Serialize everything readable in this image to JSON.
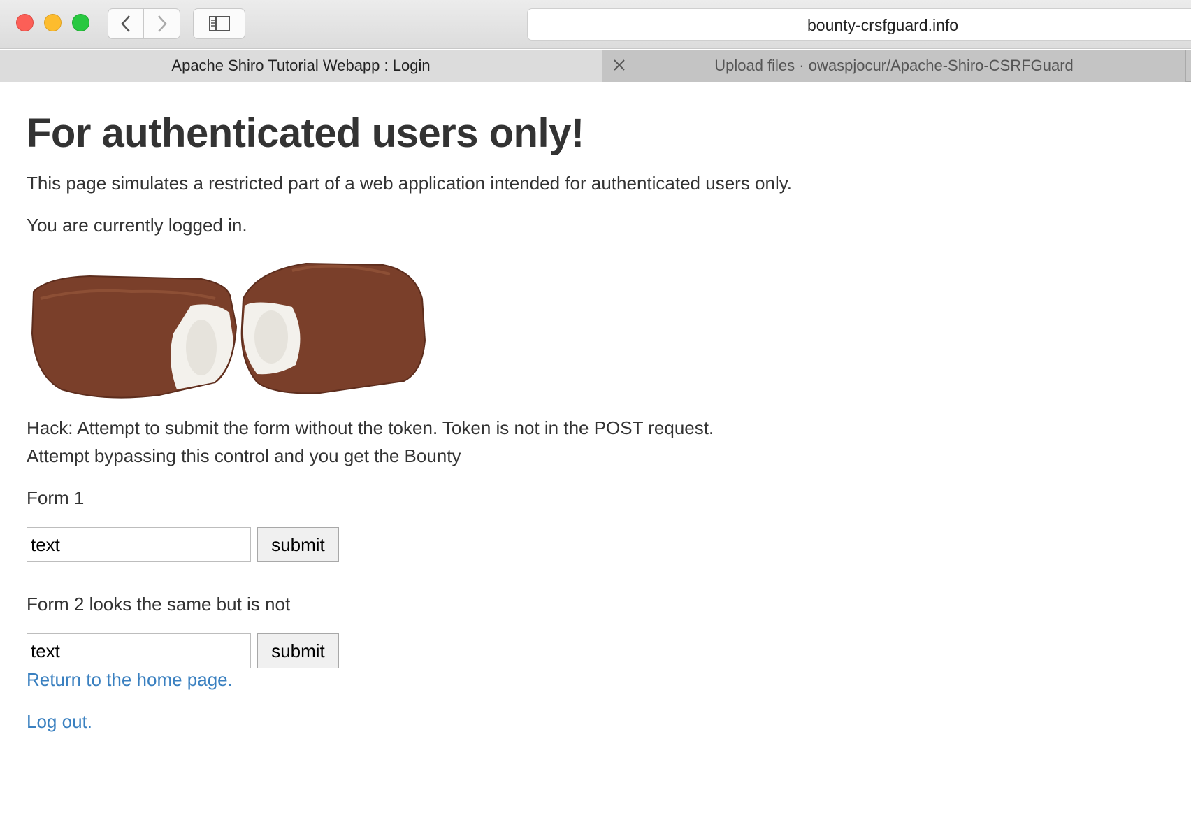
{
  "browser": {
    "url": "bounty-crsfguard.info",
    "tabs": [
      {
        "label": "Apache Shiro Tutorial Webapp : Login",
        "active": true
      },
      {
        "label": "Upload files · owaspjocur/Apache-Shiro-CSRFGuard",
        "active": false
      }
    ]
  },
  "page": {
    "title": "For authenticated users only!",
    "intro": "This page simulates a restricted part of a web application intended for authenticated users only.",
    "status": "You are currently logged in.",
    "hack_line1": "Hack: Attempt to submit the form without the token. Token is not in the POST request.",
    "hack_line2": "Attempt bypassing this control and you get the Bounty",
    "form1": {
      "label": "Form 1",
      "input_value": "text",
      "submit_label": "submit"
    },
    "form2": {
      "label": "Form 2 looks the same but is not",
      "input_value": "text",
      "submit_label": "submit"
    },
    "links": {
      "home": "Return to the home page.",
      "logout": "Log out."
    }
  },
  "colors": {
    "link": "#3a80c0",
    "text": "#333333",
    "chocolate": "#7a3f2a"
  }
}
